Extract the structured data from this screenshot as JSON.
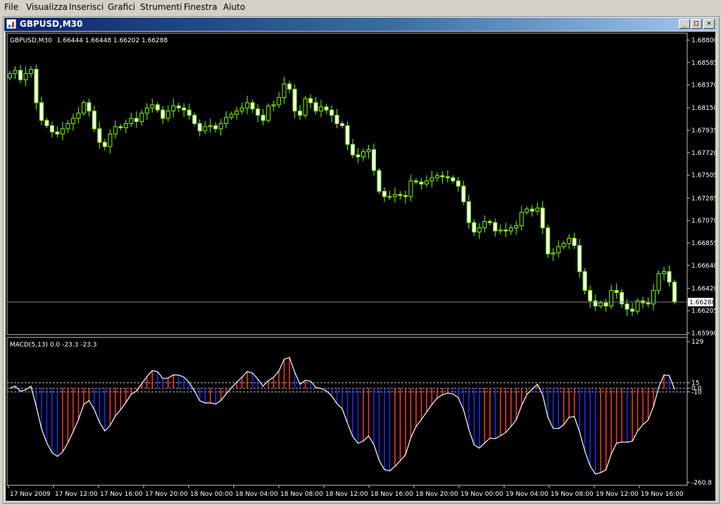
{
  "menu": [
    {
      "name": "menu-file",
      "label": "File"
    },
    {
      "name": "menu-visualizza",
      "label": "Visualizza"
    },
    {
      "name": "menu-inserisci",
      "label": "Inserisci"
    },
    {
      "name": "menu-grafici",
      "label": "Grafici"
    },
    {
      "name": "menu-strumenti",
      "label": "Strumenti"
    },
    {
      "name": "menu-finestra",
      "label": "Finestra"
    },
    {
      "name": "menu-aiuto",
      "label": "Aiuto"
    }
  ],
  "window": {
    "title": "GBPUSD,M30",
    "icon": "chart-window-icon",
    "minimize_glyph": "_",
    "maximize_glyph": "□",
    "close_glyph": "×"
  },
  "colors": {
    "background": "#000000",
    "candle": "#7cfc00",
    "candle_body_up": "#000000",
    "candle_body_down": "#ffffff",
    "axis_text": "#ffffff",
    "price_line": "#808080",
    "macd_line": "#ffffff",
    "hist_positive": "#ff3b2f",
    "hist_negative": "#2030ff",
    "level_line": "#b0b0b0"
  },
  "chart_data": [
    {
      "type": "candlestick",
      "label": "GBPUSD,M30  1.66444 1.66448 1.66202 1.66288",
      "symbol": "GBPUSD,M30",
      "ohlc_label": "1.66444 1.66448 1.66202 1.66288",
      "y_ticks": [
        "1.68800",
        "1.68585",
        "1.68370",
        "1.68150",
        "1.67935",
        "1.67720",
        "1.67505",
        "1.67285",
        "1.67070",
        "1.66855",
        "1.66640",
        "1.66420",
        "1.66205",
        "1.65990"
      ],
      "ylim": [
        1.6599,
        1.688
      ],
      "last_price": 1.66288,
      "last_price_label": "1.66288",
      "closes": [
        1.6848,
        1.6851,
        1.6842,
        1.6848,
        1.6852,
        1.682,
        1.6803,
        1.6798,
        1.6792,
        1.679,
        1.6795,
        1.68,
        1.6805,
        1.681,
        1.682,
        1.6812,
        1.6795,
        1.6782,
        1.6778,
        1.679,
        1.6797,
        1.6796,
        1.68,
        1.6805,
        1.6802,
        1.681,
        1.6815,
        1.6818,
        1.6813,
        1.6805,
        1.6812,
        1.6817,
        1.6815,
        1.6813,
        1.6808,
        1.68,
        1.6793,
        1.6797,
        1.6798,
        1.6795,
        1.68,
        1.6806,
        1.6809,
        1.6812,
        1.6815,
        1.682,
        1.6814,
        1.6808,
        1.6803,
        1.6817,
        1.6818,
        1.6825,
        1.6838,
        1.6833,
        1.6812,
        1.6808,
        1.6824,
        1.682,
        1.6812,
        1.6816,
        1.6813,
        1.6808,
        1.68,
        1.6798,
        1.678,
        1.677,
        1.6768,
        1.6773,
        1.6775,
        1.6755,
        1.6735,
        1.673,
        1.673,
        1.6732,
        1.6731,
        1.673,
        1.6745,
        1.6744,
        1.6742,
        1.6745,
        1.6748,
        1.675,
        1.6749,
        1.6748,
        1.6745,
        1.674,
        1.6725,
        1.6705,
        1.6696,
        1.67,
        1.6706,
        1.6705,
        1.6697,
        1.6698,
        1.6697,
        1.67,
        1.6702,
        1.6715,
        1.6718,
        1.6716,
        1.6719,
        1.67,
        1.6675,
        1.6676,
        1.6682,
        1.6685,
        1.669,
        1.6683,
        1.6658,
        1.664,
        1.663,
        1.6625,
        1.6628,
        1.6625,
        1.664,
        1.6638,
        1.6627,
        1.6622,
        1.662,
        1.663,
        1.6628,
        1.6627,
        1.664,
        1.6656,
        1.6658,
        1.6648,
        1.6629
      ],
      "x_ticks": [
        "17 Nov 2009",
        "17 Nov 12:00",
        "17 Nov 16:00",
        "17 Nov 20:00",
        "18 Nov 00:00",
        "18 Nov 04:00",
        "18 Nov 08:00",
        "18 Nov 12:00",
        "18 Nov 16:00",
        "18 Nov 20:00",
        "19 Nov 00:00",
        "19 Nov 04:00",
        "19 Nov 08:00",
        "19 Nov 12:00",
        "19 Nov 16:00"
      ]
    },
    {
      "type": "histogram",
      "label": "MACD(5,13) 0.0 -23.3 -23.3",
      "y_ticks": [
        "129",
        "15",
        "0.0",
        "-10",
        "-260.8"
      ],
      "ylim": [
        -260.8,
        129
      ],
      "levels": [
        15,
        0,
        -10
      ],
      "macd_label": "MACD",
      "macd_params": "(5,13) 0.0 -23.3 -23.3"
    }
  ]
}
